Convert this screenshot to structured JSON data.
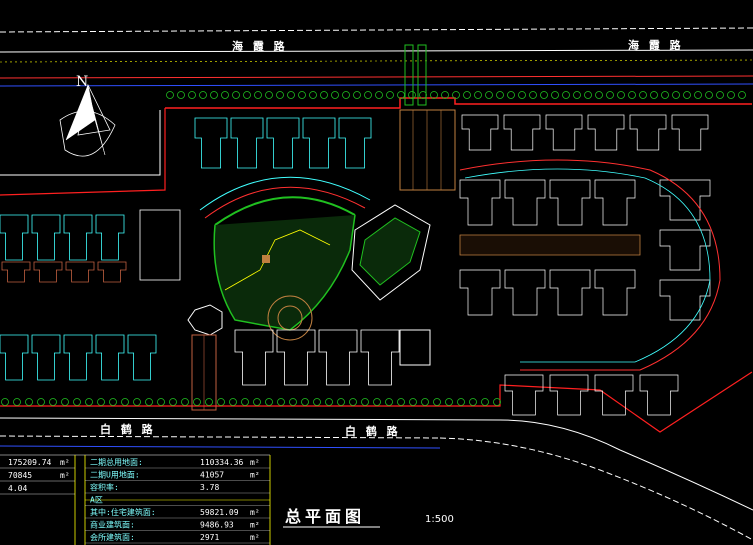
{
  "roads": {
    "top_left": "海 霞 路",
    "top_right": "海 霞 路",
    "bottom_left": "白 鹤 路",
    "bottom_right": "白 鹤 路"
  },
  "north_label": "N",
  "title": "总平面图",
  "scale": "1:500",
  "stats_left": [
    {
      "value": "175209.74",
      "unit": "m²"
    },
    {
      "value": "70845",
      "unit": "m²"
    },
    {
      "value": "4.04",
      "unit": ""
    }
  ],
  "stats_right": [
    {
      "label": "二期总用地面:",
      "value": "110334.36",
      "unit": "m²"
    },
    {
      "label": "二期U用地面:",
      "value": "41057",
      "unit": "m²"
    },
    {
      "label": "容积率:",
      "value": "3.78",
      "unit": ""
    },
    {
      "label": "A区",
      "value": "",
      "unit": ""
    },
    {
      "label": "其中:住宅建筑面:",
      "value": "59821.09",
      "unit": "m²"
    },
    {
      "label": "商业建筑面:",
      "value": "9486.93",
      "unit": "m²"
    },
    {
      "label": "会所建筑面:",
      "value": "2971",
      "unit": "m²"
    }
  ]
}
